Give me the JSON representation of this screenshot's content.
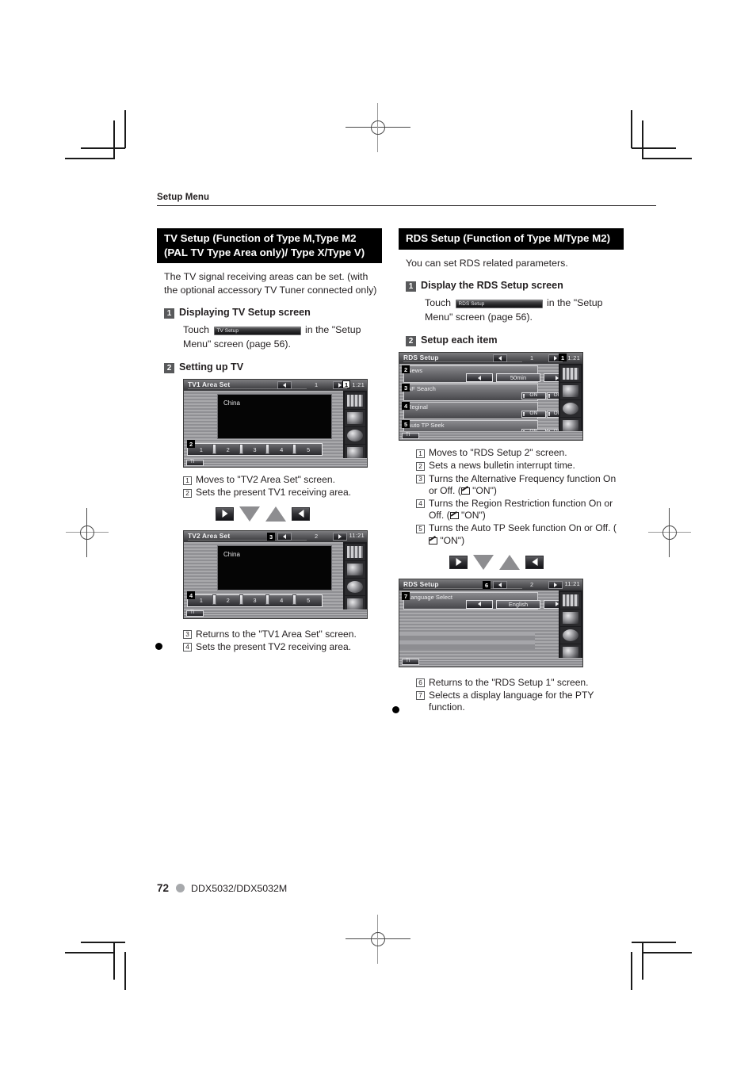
{
  "header": {
    "section": "Setup Menu"
  },
  "footer": {
    "page": "72",
    "model": "DDX5032/DDX5032M"
  },
  "left": {
    "bar_line1": "TV Setup (Function of Type M,Type M2",
    "bar_line2": "(PAL TV Type Area only)/ Type X/Type V)",
    "intro": "The TV signal receiving areas can be set. (with the optional accessory TV Tuner connected only)",
    "step1_num": "1",
    "step1_title": "Displaying TV Setup screen",
    "touch_pre": "Touch",
    "touch_button_label": "TV Setup",
    "touch_post": "in the \"Setup Menu\" screen (page 56).",
    "step2_num": "2",
    "step2_title": "Setting up TV",
    "shot1": {
      "title": "TV1 Area Set",
      "page": "1",
      "clock": "1:21",
      "video_text": "China",
      "presets": [
        "1",
        "2",
        "3",
        "4",
        "5"
      ],
      "ti_label": "TI",
      "chip_right": "1",
      "chip_preset": "2"
    },
    "list1": [
      {
        "num": "1",
        "text": "Moves to \"TV2 Area Set\" screen."
      },
      {
        "num": "2",
        "text": "Sets the present TV1 receiving area."
      }
    ],
    "shot2": {
      "title": "TV2 Area Set",
      "page": "2",
      "clock": "11:21",
      "video_text": "China",
      "presets": [
        "1",
        "2",
        "3",
        "4",
        "5"
      ],
      "ti_label": "TI",
      "chip_left": "3",
      "chip_preset": "4"
    },
    "list2": [
      {
        "num": "3",
        "text": "Returns to the \"TV1 Area Set\" screen."
      },
      {
        "num": "4",
        "text": "Sets the present TV2 receiving area."
      }
    ]
  },
  "right": {
    "bar_line1": "RDS Setup (Function of Type M/Type M2)",
    "intro": "You can set RDS related parameters.",
    "step1_num": "1",
    "step1_title": "Display the RDS Setup screen",
    "touch_pre": "Touch",
    "touch_button_label": "RDS Setup",
    "touch_post": "in the \"Setup Menu\" screen (page 56).",
    "step2_num": "2",
    "step2_title": "Setup each item",
    "shot1": {
      "title": "RDS Setup",
      "page": "1",
      "clock": "1:21",
      "chip_right": "1",
      "ti_label": "TI",
      "rows": [
        {
          "chip": "2",
          "label": "News",
          "value": "50min",
          "type": "value"
        },
        {
          "chip": "3",
          "label": "AF Search",
          "on": "ON",
          "off": "OFF",
          "type": "toggle"
        },
        {
          "chip": "4",
          "label": "Reginal",
          "on": "ON",
          "off": "OFF",
          "type": "toggle"
        },
        {
          "chip": "5",
          "label": "Auto TP Seek",
          "on": "ON",
          "off": "OFF",
          "type": "toggle"
        }
      ]
    },
    "list1": [
      {
        "num": "1",
        "text": "Moves to \"RDS Setup 2\" screen."
      },
      {
        "num": "2",
        "text": "Sets a news bulletin interrupt time."
      },
      {
        "num": "3",
        "text": "Turns the Alternative Frequency function On or Off. (",
        "marker": true,
        "text2": " \"ON\")"
      },
      {
        "num": "4",
        "text": "Turns the Region Restriction function On or Off. (",
        "marker": true,
        "text2": " \"ON\")"
      },
      {
        "num": "5",
        "text": "Turns the Auto TP Seek function On or Off. (",
        "marker": true,
        "text2": " \"ON\")"
      }
    ],
    "shot2": {
      "title": "RDS Setup",
      "page": "2",
      "clock": "11:21",
      "chip_left": "6",
      "chip_row": "7",
      "ti_label": "TI",
      "row_label": "Language Select",
      "row_value": "English"
    },
    "list2": [
      {
        "num": "6",
        "text": "Returns to the \"RDS Setup 1\" screen."
      },
      {
        "num": "7",
        "text": "Selects a display language for the PTY function."
      }
    ]
  }
}
